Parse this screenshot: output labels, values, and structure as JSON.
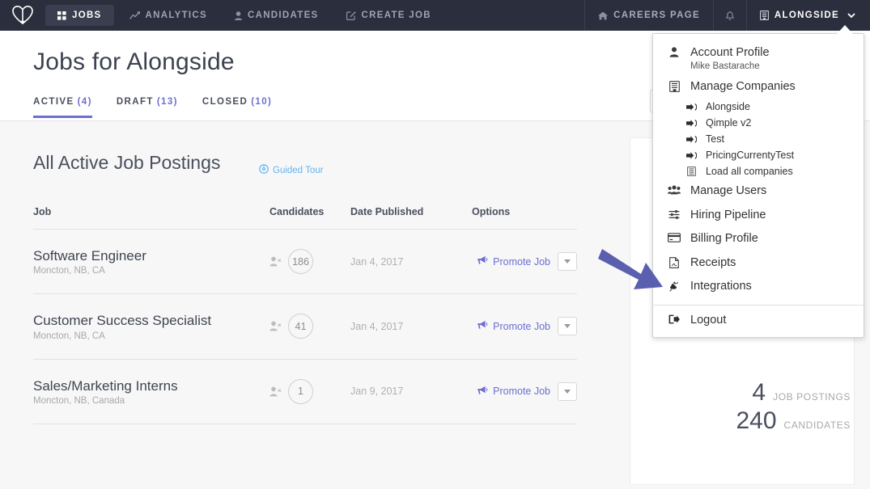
{
  "topnav": {
    "logo": "alongside-logo",
    "items": [
      {
        "label": "JOBS",
        "icon": "grid-icon",
        "active": true
      },
      {
        "label": "ANALYTICS",
        "icon": "chart-line-icon",
        "active": false
      },
      {
        "label": "CANDIDATES",
        "icon": "person-icon",
        "active": false
      },
      {
        "label": "CREATE JOB",
        "icon": "pencil-square-icon",
        "active": false
      }
    ],
    "careers_page": {
      "label": "CAREERS PAGE",
      "icon": "home-icon"
    },
    "notifications": {
      "icon": "bell-icon"
    },
    "company": {
      "label": "ALONGSIDE",
      "icon": "building-icon",
      "caret": "⌄"
    }
  },
  "header": {
    "title": "Jobs for Alongside",
    "tabs": [
      {
        "label": "ACTIVE",
        "count": "(4)",
        "active": true
      },
      {
        "label": "DRAFT",
        "count": "(13)",
        "active": false
      },
      {
        "label": "CLOSED",
        "count": "(10)",
        "active": false
      }
    ],
    "search": {
      "placeholder": "",
      "value": ""
    }
  },
  "main": {
    "section_title": "All Active Job Postings",
    "guided_tour": {
      "label": "Guided Tour",
      "icon": "compass-icon"
    },
    "columns": {
      "job": "Job",
      "candidates": "Candidates",
      "date_published": "Date Published",
      "options": "Options"
    },
    "rows": [
      {
        "title": "Software Engineer",
        "location": "Moncton, NB, CA",
        "candidates": "186",
        "date": "Jan 4, 2017",
        "promote_label": "Promote Job"
      },
      {
        "title": "Customer Success Specialist",
        "location": "Moncton, NB, CA",
        "candidates": "41",
        "date": "Jan 4, 2017",
        "promote_label": "Promote Job"
      },
      {
        "title": "Sales/Marketing Interns",
        "location": "Moncton, NB, Canada",
        "candidates": "1",
        "date": "Jan 9, 2017",
        "promote_label": "Promote Job"
      }
    ]
  },
  "right_panel": {
    "stats": [
      {
        "number": "4",
        "label": "JOB POSTINGS"
      },
      {
        "number": "240",
        "label": "CANDIDATES"
      }
    ]
  },
  "dropdown": {
    "account": {
      "label": "Account Profile",
      "user": "Mike Bastarache",
      "icon": "person-icon"
    },
    "manage_companies": {
      "label": "Manage Companies",
      "icon": "building-icon"
    },
    "companies": [
      {
        "label": "Alongside",
        "icon": "signin-icon"
      },
      {
        "label": "Qimple v2",
        "icon": "signin-icon"
      },
      {
        "label": "Test",
        "icon": "signin-icon"
      },
      {
        "label": "PricingCurrentyTest",
        "icon": "signin-icon"
      },
      {
        "label": "Load all companies",
        "icon": "building-icon"
      }
    ],
    "items": [
      {
        "label": "Manage Users",
        "icon": "users-icon"
      },
      {
        "label": "Hiring Pipeline",
        "icon": "sliders-icon"
      },
      {
        "label": "Billing Profile",
        "icon": "credit-card-icon"
      },
      {
        "label": "Receipts",
        "icon": "file-pdf-icon"
      },
      {
        "label": "Integrations",
        "icon": "plug-icon"
      }
    ],
    "logout": {
      "label": "Logout",
      "icon": "signout-icon"
    }
  },
  "annotation": {
    "arrow_color": "#5b5faf",
    "points_to": "Integrations"
  },
  "colors": {
    "nav_bg": "#2b2e3c",
    "accent": "#6c6fd0",
    "link": "#62b4f0",
    "body_bg": "#f7f7f7",
    "arrow": "#5b5faf"
  }
}
